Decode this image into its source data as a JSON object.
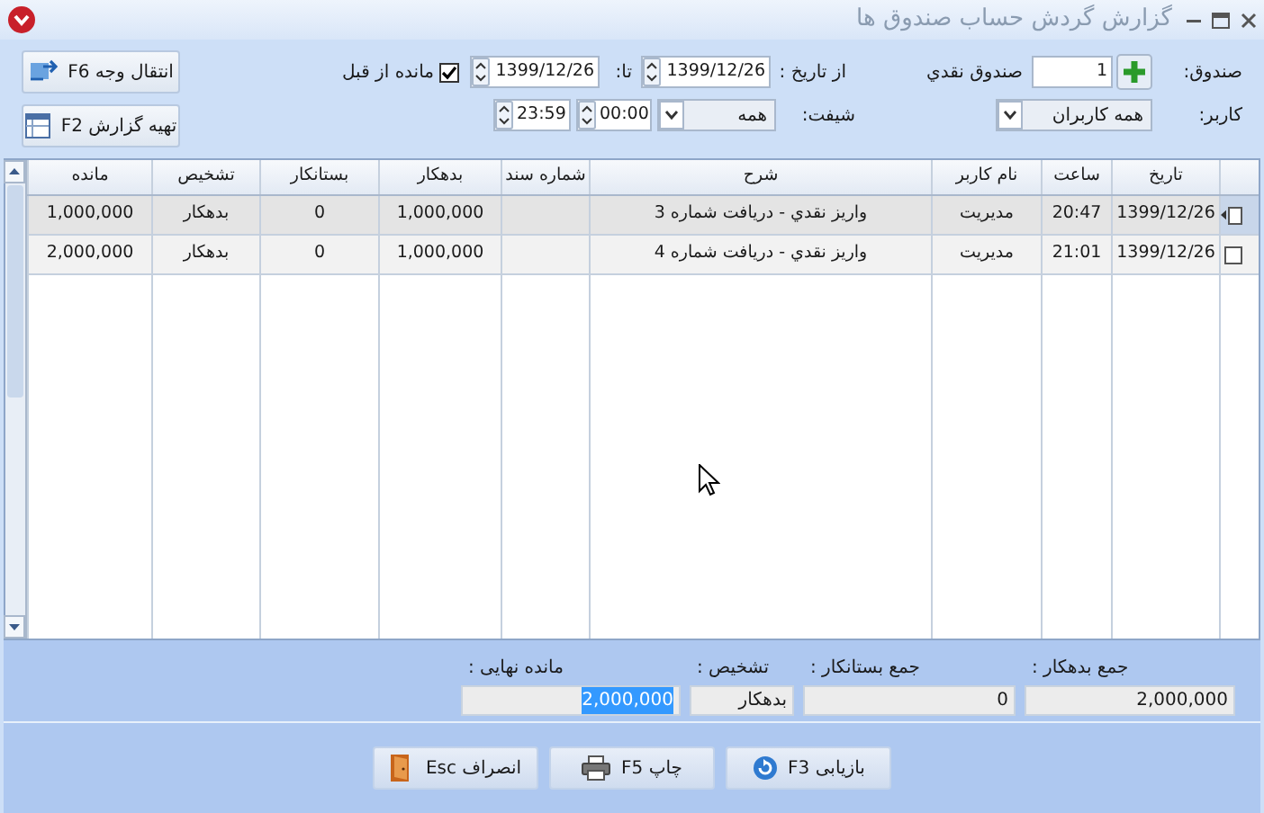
{
  "window": {
    "title": "گزارش گردش حساب صندوق ها"
  },
  "filters": {
    "fund_label": "صندوق:",
    "fund_number": "1",
    "fund_name": "صندوق نقدي",
    "from_label": "از تاریخ :",
    "from_date": "1399/12/26",
    "to_label": "تا:",
    "to_date": "1399/12/26",
    "previous_balance": {
      "label": "مانده از قبل",
      "checked": true
    },
    "user_label": "کاربر:",
    "user": "همه کاربران",
    "shift_label": "شیفت:",
    "shift": "همه",
    "time_from": "00:00",
    "time_to": "23:59"
  },
  "side_buttons": [
    {
      "label": "انتقال وجه F6",
      "kind": "transfer"
    },
    {
      "label": "تهیه گزارش F2",
      "kind": "report"
    }
  ],
  "table": {
    "columns": [
      "تاریخ",
      "ساعت",
      "نام کاربر",
      "شرح",
      "شماره سند",
      "بدهکار",
      "بستانکار",
      "تشخیص",
      "مانده"
    ],
    "rows": [
      {
        "selected": true,
        "checked": false,
        "cells": [
          "1399/12/26",
          "20:47",
          "مدیریت",
          "واریز نقدي - دریافت شماره 3",
          null,
          "1,000,000",
          "0",
          "بدهکار",
          "1,000,000"
        ]
      },
      {
        "selected": false,
        "checked": false,
        "cells": [
          "1399/12/26",
          "21:01",
          "مدیریت",
          "واریز نقدي - دریافت شماره 4",
          null,
          "1,000,000",
          "0",
          "بدهکار",
          "2,000,000"
        ]
      }
    ]
  },
  "totals": [
    {
      "label": "جمع بدهکار :",
      "value": "2,000,000",
      "selected": false
    },
    {
      "label": "جمع بستانکار :",
      "value": "0",
      "selected": false
    },
    {
      "label": "تشخیص :",
      "value": "بدهکار",
      "selected": false
    },
    {
      "label": "مانده نهایی :",
      "value": "2,000,000",
      "selected": true
    }
  ],
  "buttons": [
    {
      "label": "بازیابی F3",
      "kind": "refresh"
    },
    {
      "label": "چاپ F5",
      "kind": "print"
    },
    {
      "label": "انصراف Esc",
      "kind": "exit"
    }
  ]
}
